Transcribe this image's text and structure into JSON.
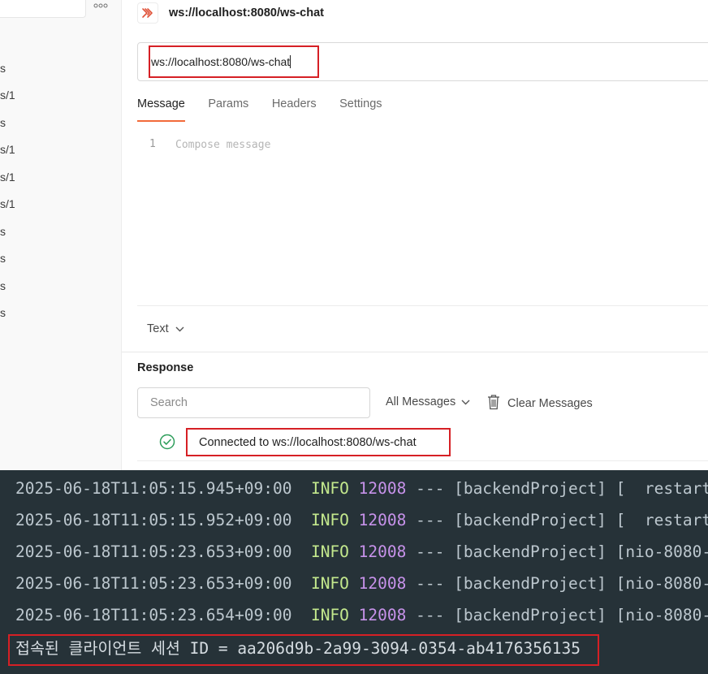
{
  "sidebar": {
    "items": [
      "s",
      "s/1",
      "s",
      "s/1",
      "s/1",
      "s/1",
      "s",
      "s",
      "s",
      "s"
    ]
  },
  "tab": {
    "title": "ws://localhost:8080/ws-chat",
    "icon": "websocket-icon"
  },
  "url_bar": {
    "value": "ws://localhost:8080/ws-chat"
  },
  "request_tabs": [
    "Message",
    "Params",
    "Headers",
    "Settings"
  ],
  "editor": {
    "line_number": "1",
    "placeholder": "Compose message"
  },
  "format": {
    "label": "Text"
  },
  "response": {
    "title": "Response",
    "search_placeholder": "Search",
    "filter_label": "All Messages",
    "clear_label": "Clear Messages",
    "messages": [
      {
        "text": "Connected to ws://localhost:8080/ws-chat",
        "status": "connected",
        "icon": "check-circle-icon"
      }
    ]
  },
  "terminal": {
    "lines": [
      {
        "timestamp": "2025-06-18T11:05:15.945+09:00",
        "level": "INFO",
        "pid": "12008",
        "rest": "--- [backendProject] [  restart"
      },
      {
        "timestamp": "2025-06-18T11:05:15.952+09:00",
        "level": "INFO",
        "pid": "12008",
        "rest": "--- [backendProject] [  restart"
      },
      {
        "timestamp": "2025-06-18T11:05:23.653+09:00",
        "level": "INFO",
        "pid": "12008",
        "rest": "--- [backendProject] [nio-8080-"
      },
      {
        "timestamp": "2025-06-18T11:05:23.653+09:00",
        "level": "INFO",
        "pid": "12008",
        "rest": "--- [backendProject] [nio-8080-"
      },
      {
        "timestamp": "2025-06-18T11:05:23.654+09:00",
        "level": "INFO",
        "pid": "12008",
        "rest": "--- [backendProject] [nio-8080-"
      }
    ],
    "session_line": "접속된 클라이언트 세션 ID = aa206d9b-2a99-3094-0354-ab4176356135"
  },
  "colors": {
    "highlight": "#d62025",
    "active_tab_underline": "#f26b3a",
    "terminal_bg": "#263238",
    "log_level": "#c3e88d",
    "log_pid": "#c792ea",
    "connected_icon": "#2e9e5b"
  }
}
